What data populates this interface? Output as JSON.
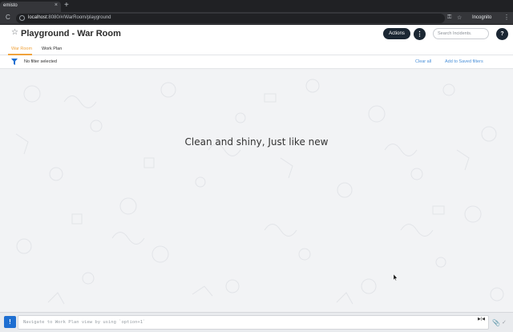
{
  "browser": {
    "tab_title": "emisto",
    "tab_close": "×",
    "new_tab": "+",
    "reload": "C",
    "url_host": "localhost",
    "url_path": ":8080/#/WarRoom/playground",
    "incognito_label": "Incognito",
    "kebab": "⋮",
    "key_icon": "⚿",
    "star_icon": "☆"
  },
  "header": {
    "star": "☆",
    "title": "Playground - War Room",
    "actions_label": "Actions",
    "more_label": "⋮",
    "search_placeholder": "Search Incidents.",
    "help_label": "?"
  },
  "tabs": [
    {
      "label": "War Room",
      "active": true
    },
    {
      "label": "Work Plan",
      "active": false
    }
  ],
  "filter": {
    "status": "No filter selected",
    "clear_all": "Clear all",
    "add_saved": "Add to Saved filters"
  },
  "main": {
    "empty_message": "Clean and shiny, Just like new"
  },
  "cli": {
    "button": "!",
    "placeholder": "Navigate to Work Plan view by using `option+1`",
    "right_icon": "▶|◀",
    "clip_icon": "📎",
    "check_icon": "✓"
  },
  "colors": {
    "accent": "#f0a33c",
    "primary_dark": "#1b2733",
    "link": "#4a90d9",
    "cli_button": "#1f6fd1"
  }
}
